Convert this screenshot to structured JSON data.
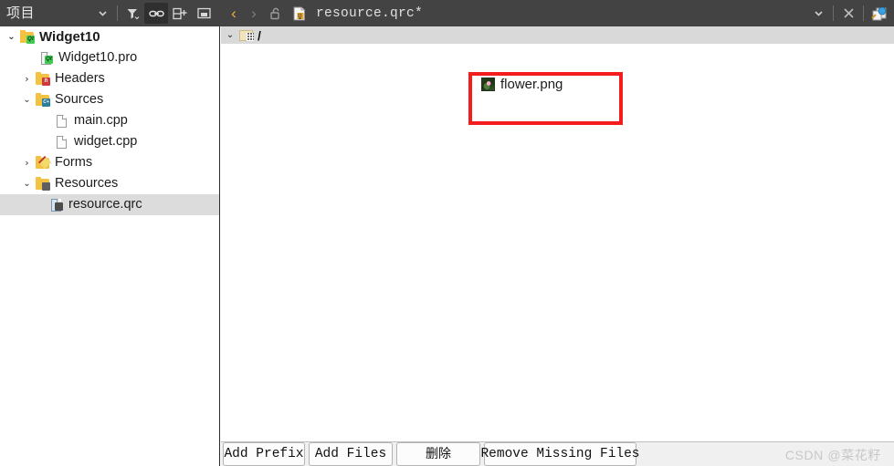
{
  "toolbar": {
    "project_selector_label": "项目",
    "icons": {
      "dropdown": "chevron-down-icon",
      "filter": "filter-icon",
      "link": "link-icon",
      "split": "split-pane-add-icon",
      "collapse": "collapse-pane-icon"
    },
    "nav": {
      "back": "‹",
      "forward": "›"
    },
    "lock_state": "unlocked",
    "document_name": "resource.qrc*",
    "right_icons": {
      "dropdown": "chevron-down-icon",
      "close": "close-icon",
      "split_editor": "split-editor-icon"
    }
  },
  "project_tree": {
    "items": [
      {
        "label": "Widget10",
        "indent": 0,
        "twisty": "v",
        "icon": "qt-project-folder-icon",
        "bold": true,
        "selected": false
      },
      {
        "label": "Widget10.pro",
        "indent": 1,
        "twisty": "",
        "icon": "qt-pro-file-icon",
        "bold": false,
        "selected": false
      },
      {
        "label": "Headers",
        "indent": 1,
        "twisty": ">",
        "icon": "headers-folder-icon",
        "bold": false,
        "selected": false
      },
      {
        "label": "Sources",
        "indent": 1,
        "twisty": "v",
        "icon": "sources-folder-icon",
        "bold": false,
        "selected": false
      },
      {
        "label": "main.cpp",
        "indent": 2,
        "twisty": "",
        "icon": "cpp-file-icon",
        "bold": false,
        "selected": false
      },
      {
        "label": "widget.cpp",
        "indent": 2,
        "twisty": "",
        "icon": "cpp-file-icon",
        "bold": false,
        "selected": false
      },
      {
        "label": "Forms",
        "indent": 1,
        "twisty": ">",
        "icon": "forms-folder-icon",
        "bold": false,
        "selected": false
      },
      {
        "label": "Resources",
        "indent": 1,
        "twisty": "v",
        "icon": "resources-folder-icon",
        "bold": false,
        "selected": false
      },
      {
        "label": "resource.qrc",
        "indent": 2,
        "twisty": "",
        "icon": "qrc-file-icon",
        "bold": false,
        "selected": true
      }
    ]
  },
  "resource_editor": {
    "prefix_row": {
      "twisty": "v",
      "label": "/",
      "icon": "qrc-prefix-folder-icon"
    },
    "files": [
      {
        "name": "flower.png",
        "icon": "flower-thumbnail-icon"
      }
    ],
    "highlight": {
      "color": "#f41d1d",
      "annotation": "red-rectangle-highlight"
    }
  },
  "bottom_buttons": [
    {
      "label": "Add Prefix",
      "name": "add-prefix-button"
    },
    {
      "label": "Add Files",
      "name": "add-files-button"
    },
    {
      "label": "删除",
      "name": "remove-button"
    },
    {
      "label": "Remove Missing Files",
      "name": "remove-missing-files-button"
    }
  ],
  "watermark": {
    "text": "CSDN @菜花籽"
  },
  "colors": {
    "toolbar_bg": "#434343",
    "selection_bg": "#dcdcdc",
    "prefix_row_bg": "#d9d9d9",
    "highlight_red": "#f41d1d",
    "bottom_bar_bg": "#f0f0f0"
  }
}
